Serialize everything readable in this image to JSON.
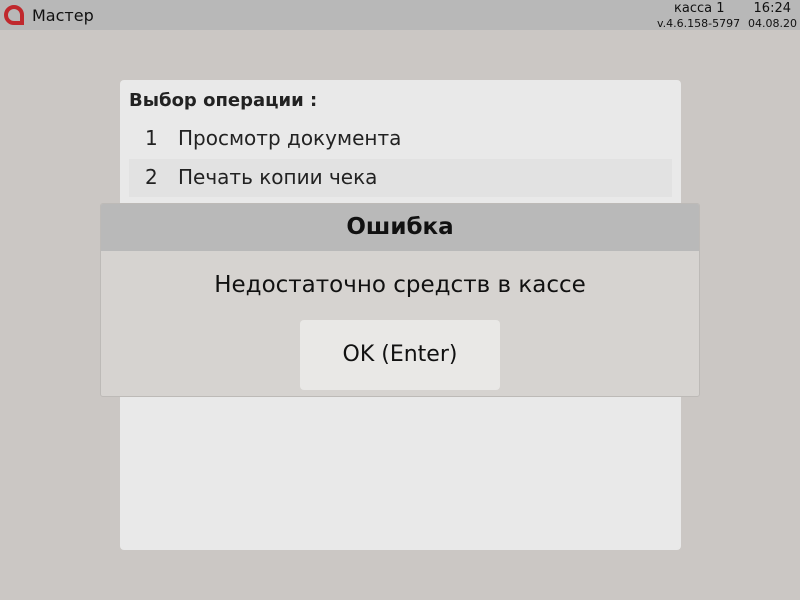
{
  "header": {
    "app_title": "Мастер",
    "logo_icon": "red-ring-logo-icon",
    "kassa": "касса 1",
    "time": "16:24",
    "version": "v.4.6.158-5797",
    "date": "04.08.20",
    "colors": {
      "bar": "#b8b8b8",
      "logo": "#c0282d"
    }
  },
  "menu": {
    "title": "Выбор операции :",
    "items": [
      {
        "number": "1",
        "label": "Просмотр документа"
      },
      {
        "number": "2",
        "label": "Печать копии чека",
        "selected": true
      }
    ]
  },
  "dialog": {
    "title": "Ошибка",
    "message": "Недостаточно средств в кассе",
    "ok_button": "OK (Enter)"
  }
}
